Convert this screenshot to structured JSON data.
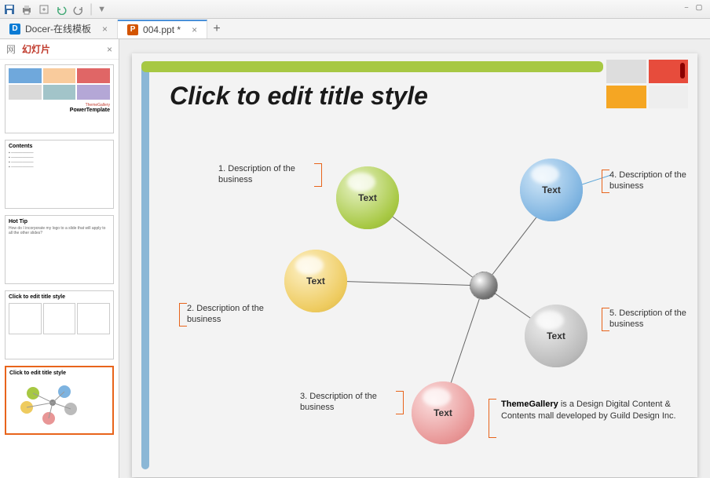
{
  "toolbar": {
    "tabs": [
      {
        "label": "Docer-在线模板",
        "icon_color": "#0a7bd4"
      },
      {
        "label": "004.ppt *",
        "icon_color": "#d35400"
      }
    ]
  },
  "side_panel": {
    "left_tab": "网",
    "tab_label": "幻灯片",
    "thumbs": [
      {
        "title": "PowerTemplate",
        "sub": "ThemeGallery"
      },
      {
        "title": "Contents"
      },
      {
        "title": "Hot Tip",
        "body": "How do I incorporate my logo to a slide that will apply to all the other slides?"
      },
      {
        "title": "Click to edit title style"
      },
      {
        "title": "Click to edit title style"
      }
    ]
  },
  "slide": {
    "title": "Click to edit title style",
    "nodes": {
      "n1": {
        "num": "1.",
        "text": "Description of the business",
        "ball": "Text"
      },
      "n2": {
        "num": "2.",
        "text": "Description of the business",
        "ball": "Text"
      },
      "n3": {
        "num": "3.",
        "text": "Description of the business",
        "ball": "Text"
      },
      "n4": {
        "num": "4.",
        "text": "Description of the business",
        "ball": "Text"
      },
      "n5": {
        "num": "5.",
        "text": "Description of the business",
        "ball": "Text"
      }
    },
    "footer_bold": "ThemeGallery",
    "footer_rest": " is a Design Digital Content & Contents mall developed by Guild Design Inc."
  }
}
